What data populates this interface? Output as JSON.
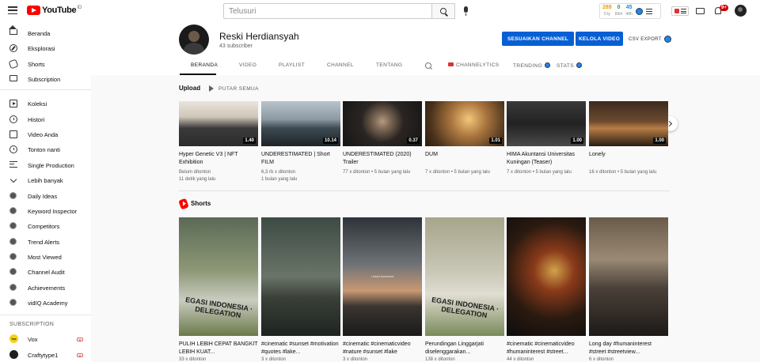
{
  "header": {
    "logo_text": "YouTube",
    "logo_superscript": "ID",
    "search_placeholder": "Telusuri",
    "vidiq": {
      "stats": [
        {
          "num": "289",
          "lbl": "0 ty",
          "color": "#e5a00d"
        },
        {
          "num": "0",
          "lbl": "60m",
          "color": "#2e9e3e"
        },
        {
          "num": "45",
          "lbl": "48h",
          "color": "#2b82d9"
        }
      ]
    },
    "notification_count": "9+"
  },
  "sidebar": {
    "main": [
      {
        "label": "Beranda",
        "icon": "home-icon"
      },
      {
        "label": "Eksplorasi",
        "icon": "compass-icon"
      },
      {
        "label": "Shorts",
        "icon": "shorts-icon"
      },
      {
        "label": "Subscription",
        "icon": "subscriptions-icon"
      }
    ],
    "library": [
      {
        "label": "Koleksi",
        "icon": "library-icon"
      },
      {
        "label": "Histori",
        "icon": "history-icon"
      },
      {
        "label": "Video Anda",
        "icon": "your-videos-icon"
      },
      {
        "label": "Tonton nanti",
        "icon": "watch-later-icon"
      },
      {
        "label": "Single Production",
        "icon": "playlist-icon"
      },
      {
        "label": "Lebih banyak",
        "icon": "chevron-down-icon"
      }
    ],
    "vidiq": [
      {
        "label": "Daily Ideas"
      },
      {
        "label": "Keyword Inspector"
      },
      {
        "label": "Competitors"
      },
      {
        "label": "Trend Alerts"
      },
      {
        "label": "Most Viewed"
      },
      {
        "label": "Channel Audit"
      },
      {
        "label": "Achievements"
      },
      {
        "label": "vidIQ Academy"
      }
    ],
    "subscription_heading": "SUBSCRIPTION",
    "subscriptions": [
      {
        "label": "Vox",
        "avatar_color": "#f2d21b",
        "avatar_text": "Vox"
      },
      {
        "label": "Craftytype1",
        "avatar_color": "#1e1e1e",
        "avatar_text": ""
      }
    ]
  },
  "channel": {
    "name": "Reski Herdiansyah",
    "subscribers": "43 subscriber",
    "customize_button": "SESUAIKAN CHANNEL",
    "manage_button": "KELOLA VIDEO",
    "csv_export": "CSV EXPORT",
    "tabs": [
      {
        "label": "BERANDA",
        "active": true
      },
      {
        "label": "VIDEO",
        "active": false
      },
      {
        "label": "PLAYLIST",
        "active": false
      },
      {
        "label": "CHANNEL",
        "active": false
      },
      {
        "label": "TENTANG",
        "active": false
      },
      {
        "label": "CHANNELYTICS",
        "active": false
      },
      {
        "label": "TRENDING",
        "active": false
      },
      {
        "label": "STATS",
        "active": false
      }
    ]
  },
  "uploads": {
    "title": "Upload",
    "play_all": "PUTAR SEMUA",
    "videos": [
      {
        "title": "Hyper Genetic V3 | NFT Exhibition",
        "duration": "1.40",
        "views": "Belum ditonton",
        "age": "11 detik yang lalu"
      },
      {
        "title": "UNDERESTIMATED | Short FILM",
        "duration": "10.14",
        "views": "6,3 rb x ditonton",
        "age": "1 bulan yang lalu"
      },
      {
        "title": "UNDERESTIMATED (2020) Trailer",
        "duration": "0.37",
        "views": "77 x ditonton",
        "age": "5 bulan yang lalu"
      },
      {
        "title": "DUM",
        "duration": "1.01",
        "views": "7 x ditonton",
        "age": "5 bulan yang lalu"
      },
      {
        "title": "HIMA Akuntansi Universitas Kuningan (Teaser)",
        "duration": "1.00",
        "views": "7 x ditonton",
        "age": "5 bulan yang lalu"
      },
      {
        "title": "Lonely",
        "duration": "1.00",
        "views": "16 x ditonton",
        "age": "5 bulan yang lalu"
      }
    ]
  },
  "shorts": {
    "title": "Shorts",
    "items": [
      {
        "title": "PULIH LEBIH CEPAT BANGKIT LEBIH KUAT...",
        "views": "33 x ditonton",
        "overlay": "EGASI INDONESIA · DELEGATION"
      },
      {
        "title": "#cinematic #sunset #motivation #quotes #lake...",
        "views": "3 x ditonton",
        "overlay": ""
      },
      {
        "title": "#cinematic #cinematicvideo #nature #sunset #lake",
        "views": "3 x ditonton",
        "overlay": "I need someone"
      },
      {
        "title": "Perundingan Linggarjati diselenggarakan...",
        "views": "138 x ditonton",
        "overlay": "EGASI INDONESIA · DELEGATION"
      },
      {
        "title": "#cinematic #cinematicvideo #humaninterest #street...",
        "views": "44 x ditonton",
        "overlay": ""
      },
      {
        "title": "Long day #humaninterest #street #streetview...",
        "views": "6 x ditonton",
        "overlay": ""
      }
    ]
  }
}
